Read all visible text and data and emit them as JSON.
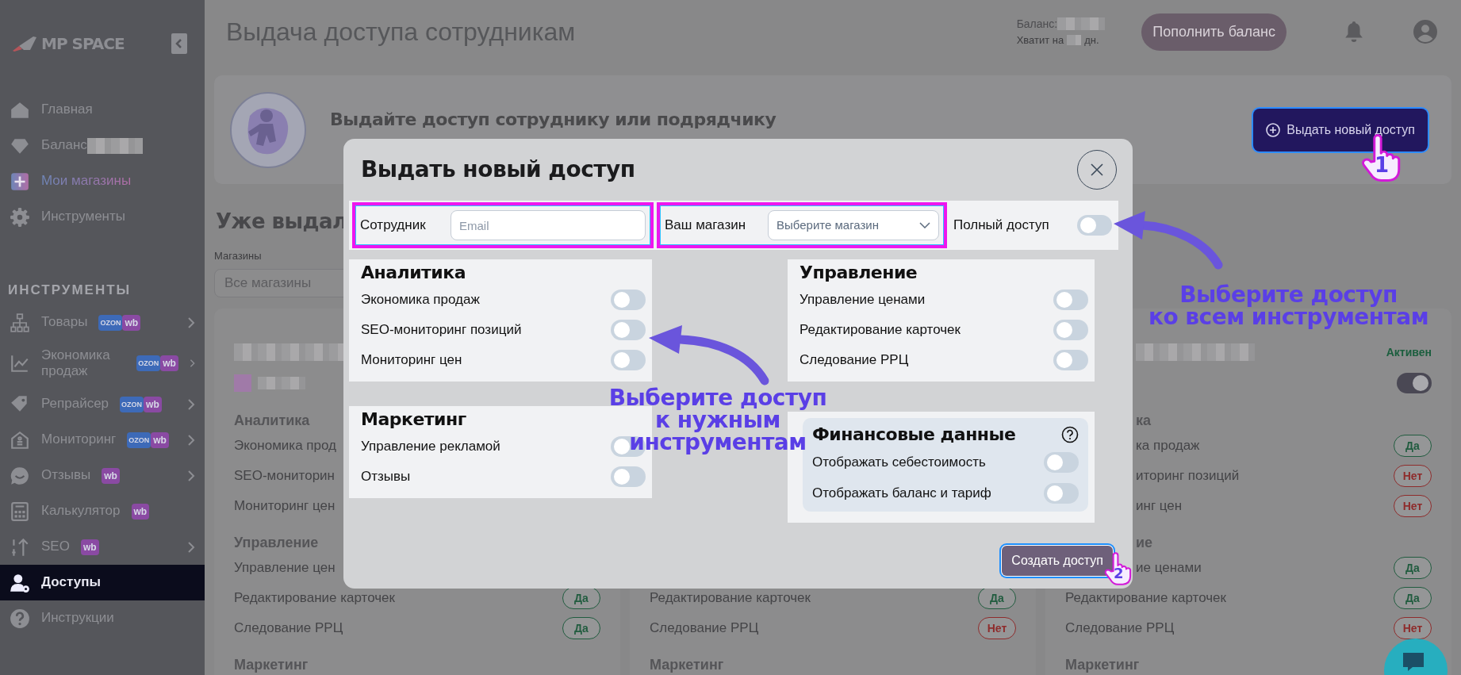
{
  "sidebar": {
    "logo": "MP SPACE",
    "items": [
      {
        "label": "Главная",
        "kind": "plain",
        "selected": false
      },
      {
        "label": "Баланс",
        "kind": "masked",
        "selected": false
      },
      {
        "label": "Мои магазины",
        "kind": "accent",
        "selected": false
      },
      {
        "label": "Инструменты",
        "kind": "plain",
        "selected": false
      }
    ],
    "section_title": "ИНСТРУМЕНТЫ",
    "tools": [
      {
        "label": "Товары",
        "badges": [
          {
            "text": "OZON",
            "color": "#3d6ab8"
          },
          {
            "text": "wb",
            "color": "#8a4aa3"
          }
        ],
        "submenu": true,
        "selected": false
      },
      {
        "label": "Экономика продаж",
        "badges": [
          {
            "text": "OZON",
            "color": "#3d6ab8"
          },
          {
            "text": "wb",
            "color": "#8a4aa3"
          }
        ],
        "submenu": true,
        "selected": false
      },
      {
        "label": "Репрайсер",
        "badges": [
          {
            "text": "OZON",
            "color": "#3d6ab8"
          },
          {
            "text": "wb",
            "color": "#8a4aa3"
          }
        ],
        "submenu": true,
        "selected": false
      },
      {
        "label": "Мониторинг",
        "badges": [
          {
            "text": "OZON",
            "color": "#3d6ab8"
          },
          {
            "text": "wb",
            "color": "#8a4aa3"
          }
        ],
        "submenu": true,
        "selected": false
      },
      {
        "label": "Отзывы",
        "badges": [
          {
            "text": "wb",
            "color": "#8a4aa3"
          }
        ],
        "submenu": true,
        "selected": false
      },
      {
        "label": "Калькулятор",
        "badges": [
          {
            "text": "wb",
            "color": "#8a4aa3"
          }
        ],
        "submenu": false,
        "selected": false
      },
      {
        "label": "SEO",
        "badges": [
          {
            "text": "wb",
            "color": "#8a4aa3"
          }
        ],
        "submenu": true,
        "selected": false
      },
      {
        "label": "Доступы",
        "submenu": false,
        "selected": true
      },
      {
        "label": "Инструкции",
        "submenu": false,
        "selected": false
      }
    ]
  },
  "header": {
    "title": "Выдача доступа сотрудникам",
    "balance_label": "Баланс:",
    "days_prefix": "Хватит на",
    "days_suffix": "дн.",
    "topup_button": "Пополнить баланс"
  },
  "hero": {
    "title": "Выдайте доступ сотруднику или подрядчику",
    "button": "Выдать новый доступ"
  },
  "issued": {
    "title": "Уже выдал",
    "filter_label": "Магазины",
    "filter_value": "Все магазины",
    "cards": [
      {
        "masked_header": true,
        "sections": [
          {
            "title": "Аналитика",
            "rows": [
              {
                "label": "Экономика прод"
              },
              {
                "label": "SEO-мониторин"
              },
              {
                "label": "Мониторинг цен"
              }
            ]
          },
          {
            "title": "Управление",
            "rows": [
              {
                "label": "Управление цен"
              },
              {
                "label": "Редактирование карточек",
                "badge": "Да",
                "color": "#215c3f"
              },
              {
                "label": "Следование РРЦ",
                "badge": "Да",
                "color": "#215c3f"
              }
            ]
          },
          {
            "title": "Маркетинг"
          }
        ]
      },
      {
        "masked_header": false,
        "sections": [
          {
            "rows": [
              {
                "label": "Редактирование карточек",
                "badge": "Да",
                "color": "#215c3f"
              },
              {
                "label": "Следование РРЦ",
                "badge": "Нет",
                "color": "#8e2c2c"
              }
            ]
          },
          {
            "title": "Маркетинг"
          }
        ]
      },
      {
        "masked_header": true,
        "status": "Активен",
        "active": true,
        "sections": [
          {
            "title": "ка",
            "clipped": true,
            "rows": [
              {
                "label": "ка продаж",
                "clipped": true,
                "badge": "Да",
                "color": "#215c3f"
              },
              {
                "label": "иторинг позиций",
                "clipped": true,
                "badge": "Нет",
                "color": "#8e2c2c"
              },
              {
                "label": "инг цен",
                "clipped": true,
                "badge": "Нет",
                "color": "#8e2c2c"
              }
            ]
          },
          {
            "title": "ие",
            "clipped": true,
            "rows": [
              {
                "label": "ие ценами",
                "clipped": true,
                "badge": "Да",
                "color": "#215c3f"
              },
              {
                "label": "Редактирование карточек",
                "badge": "Да",
                "color": "#215c3f"
              },
              {
                "label": "Следование РРЦ",
                "badge": "Нет",
                "color": "#8e2c2c"
              }
            ]
          },
          {
            "title": "Маркетинг"
          }
        ]
      }
    ]
  },
  "modal": {
    "title": "Выдать новый доступ",
    "employee_label": "Сотрудник",
    "email_placeholder": "Email",
    "store_label": "Ваш магазин",
    "store_placeholder": "Выберите магазин",
    "full_access": {
      "label": "Полный доступ",
      "on": false
    },
    "columns": [
      [
        {
          "title": "Аналитика",
          "kind": "plain",
          "rows": [
            {
              "label": "Экономика продаж",
              "on": false
            },
            {
              "label": "SEO-мониторинг позиций",
              "on": false
            },
            {
              "label": "Мониторинг цен",
              "on": false
            }
          ]
        },
        {
          "title": "Маркетинг",
          "kind": "plain",
          "rows": [
            {
              "label": "Управление рекламой",
              "on": false
            },
            {
              "label": "Отзывы",
              "on": false
            }
          ]
        }
      ],
      [
        {
          "title": "Управление",
          "kind": "plain",
          "rows": [
            {
              "label": "Управление ценами",
              "on": false
            },
            {
              "label": "Редактирование карточек",
              "on": false
            },
            {
              "label": "Следование РРЦ",
              "on": false
            }
          ]
        },
        {
          "title": "Финансовые данные",
          "kind": "nested",
          "help": true,
          "rows": [
            {
              "label": "Отображать себестоимость",
              "on": false
            },
            {
              "label": "Отображать баланс и тариф",
              "on": false
            }
          ]
        }
      ]
    ],
    "submit": "Создать доступ"
  },
  "annotations": {
    "callouts": [
      {
        "lines": [
          "Выберите доступ",
          "ко всем инструментам"
        ]
      },
      {
        "lines": [
          "Выберите доступ",
          "к нужным",
          "инструментам"
        ]
      }
    ],
    "steps": [
      {
        "number": "1"
      },
      {
        "number": "2"
      }
    ]
  }
}
